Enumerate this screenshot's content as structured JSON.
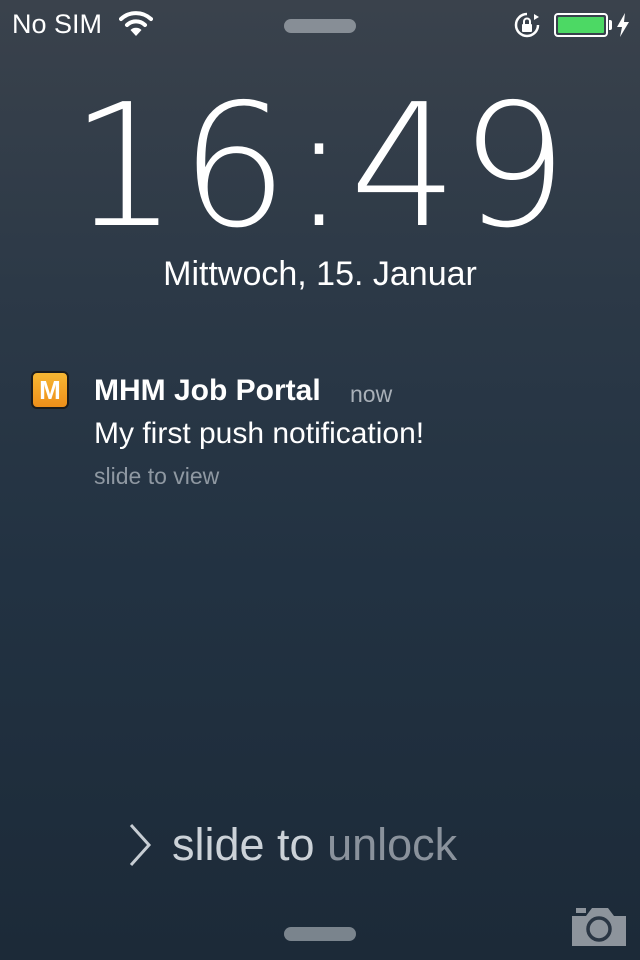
{
  "status_bar": {
    "carrier": "No SIM",
    "icons": [
      "wifi-icon",
      "rotation-lock-icon",
      "battery-icon",
      "charging-bolt-icon"
    ],
    "battery_level": 1.0,
    "battery_color": "#4cd964"
  },
  "lock_screen": {
    "time": "16:49",
    "date": "Mittwoch, 15. Januar"
  },
  "notification": {
    "app_icon_letter": "M",
    "app_icon_color": "#f5a623",
    "app_name": "MHM Job Portal",
    "time": "now",
    "message": "My first push notification!",
    "action_hint": "slide to view"
  },
  "unlock": {
    "label_bright": "slide to ",
    "label_dim": "unlock"
  },
  "camera": {
    "icon": "camera-icon"
  }
}
